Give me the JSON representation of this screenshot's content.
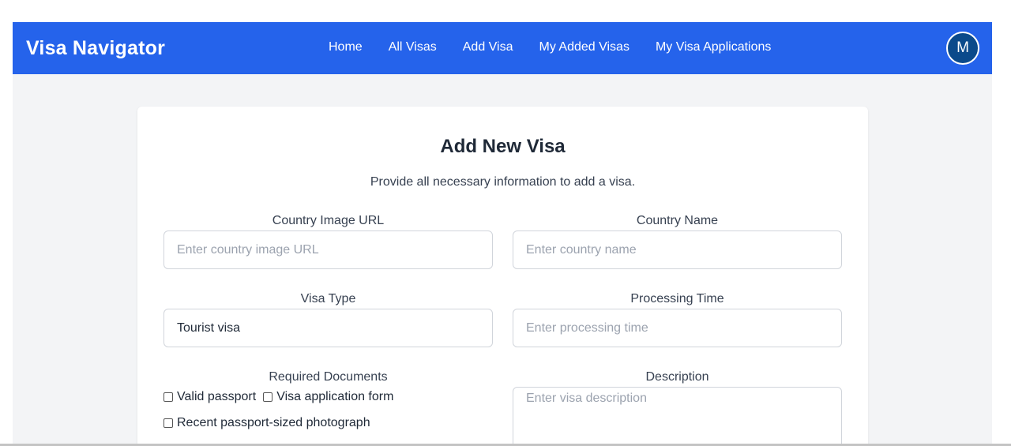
{
  "navbar": {
    "brand": "Visa Navigator",
    "links": [
      "Home",
      "All Visas",
      "Add Visa",
      "My Added Visas",
      "My Visa Applications"
    ],
    "avatar_initial": "M"
  },
  "form": {
    "title": "Add New Visa",
    "subtitle": "Provide all necessary information to add a visa.",
    "country_image_url": {
      "label": "Country Image URL",
      "placeholder": "Enter country image URL",
      "value": ""
    },
    "country_name": {
      "label": "Country Name",
      "placeholder": "Enter country name",
      "value": ""
    },
    "visa_type": {
      "label": "Visa Type",
      "value": "Tourist visa"
    },
    "processing_time": {
      "label": "Processing Time",
      "placeholder": "Enter processing time",
      "value": ""
    },
    "required_documents": {
      "label": "Required Documents",
      "options": [
        "Valid passport",
        "Visa application form",
        "Recent passport-sized photograph"
      ],
      "checked": [
        false,
        false,
        false
      ]
    },
    "description": {
      "label": "Description",
      "placeholder": "Enter visa description",
      "value": ""
    }
  },
  "colors": {
    "navbar_bg": "#2563eb",
    "avatar_bg": "#0b4a8b",
    "page_bg": "#f3f4f6"
  }
}
